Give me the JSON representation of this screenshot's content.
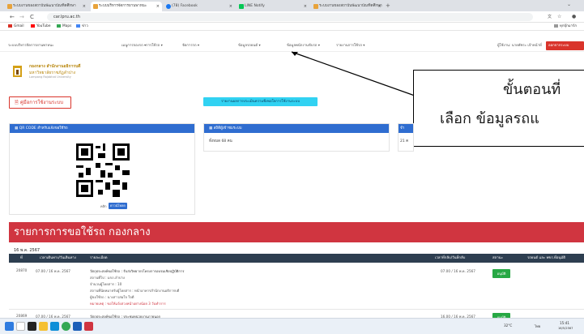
{
  "browser": {
    "tabs": [
      {
        "label": "ระบบงานของสถาบันพัฒนาบัณฑิตศึกษา",
        "active": false
      },
      {
        "label": "ระบบบริหารจัดการยานพาหนะ",
        "active": true
      },
      {
        "label": "(78) Facebook",
        "active": false
      },
      {
        "label": "LINE Notify",
        "active": false
      },
      {
        "label": "ระบบงานของสถาบันพัฒนาบัณฑิตศึกษา",
        "active": false
      }
    ],
    "new_tab": "+",
    "url": "car.lpru.ac.th",
    "bookmarks": [
      "Gmail",
      "YouTube",
      "Maps",
      "ข่าว",
      "ทุกบุ๊กมาร์ก"
    ],
    "nav_back": "←",
    "nav_forward": "→",
    "nav_reload": "C"
  },
  "site_nav": {
    "items": [
      "ระบบบริหารจัดการยานพาหนะ",
      "เมนูการจองรถ ▾",
      "การใช้รถ ▾",
      "จัดการรถ ▾",
      "ข้อมูลรถยนต์ ▾",
      "ข้อมูลพนักงานขับรถ ▾",
      "รายงานการใช้รถ ▾"
    ],
    "user": "ผู้ใช้งาน: นายพัชระ เจ้าหน้าที่",
    "logout": "ออกจากระบบ"
  },
  "org": {
    "name_line1": "กองกลาง สำนักงานอธิการบดี",
    "name_line2": "มหาวิทยาลัยราชภัฏลำปาง",
    "name_line3": "Lampang Rajabhat University"
  },
  "callout": {
    "line1": "ขั้นตอนที่",
    "line2": "เลือก ข้อมูลรถแ"
  },
  "buttons": {
    "manual": "คู่มือการใช้งานระบบ",
    "cyan": "รายงานผลการประเมินความพึงพอใจการใช้งานระบบ"
  },
  "cards": {
    "qr_title": "QR CODE สำหรับแจ้งขอใช้รถ",
    "qr_caption": "คลิก",
    "qr_badge": "ดาวน์โหลด",
    "visitors_title": "สถิติผู้เข้าชมระบบ",
    "visitors_text": "ทั้งหมด 68 คน",
    "third_title": "จำ",
    "third_text": "21 ค"
  },
  "table": {
    "title": "รายการการขอใช้รถ กองกลาง",
    "date": "16 พ.ค. 2567",
    "headers": [
      "ที่",
      "เวลาเดินทาง/วันเดินทาง",
      "รายละเอียด",
      "เวลาที่กลับ/วันที่กลับ",
      "สถานะ",
      "รถยนต์ และ พขร.ที่อนุมัติ"
    ],
    "rows": [
      {
        "no": "20870",
        "depart": "07.00 / 16 พ.ค. 2567",
        "lines": [
          "วัตถุประสงค์ขอใช้รถ : รับส่งวิทยากรโครงการอบรมเชิงปฏิบัติการ",
          "สถานที่ไป : มรภ.ลำปาง",
          "จำนวนผู้โดยสาร : 10",
          "สถานที่นัดหมายรับผู้โดยสาร : หน้าอาคารสำนักงานอธิการบดี",
          "ผู้ขอใช้รถ : นางสาวสมใจ ใจดี",
          "หมายเหตุ : ขอให้แจ้งล่วงหน้าอย่างน้อย 3 วันทำการ"
        ],
        "return": "07.00 / 16 พ.ค. 2567",
        "status": "อนุมัติ"
      },
      {
        "no": "20869",
        "depart": "07.00 / 16 พ.ค. 2567",
        "lines": [
          "วัตถุประสงค์ขอใช้รถ : ประชุมหน่วยงานภายนอก"
        ],
        "return": "16.00 / 16 พ.ค. 2567",
        "status": "อนุมัติ"
      }
    ]
  },
  "taskbar": {
    "time": "15:41",
    "date": "16/5/2567",
    "lang": "ไทย",
    "temp": "32°C"
  },
  "colors": {
    "brand_red": "#d03540",
    "header_blue": "#2f6dd0",
    "table_head": "#2d3e50",
    "status_green": "#27a844",
    "cyan_button": "#31d2f2"
  }
}
